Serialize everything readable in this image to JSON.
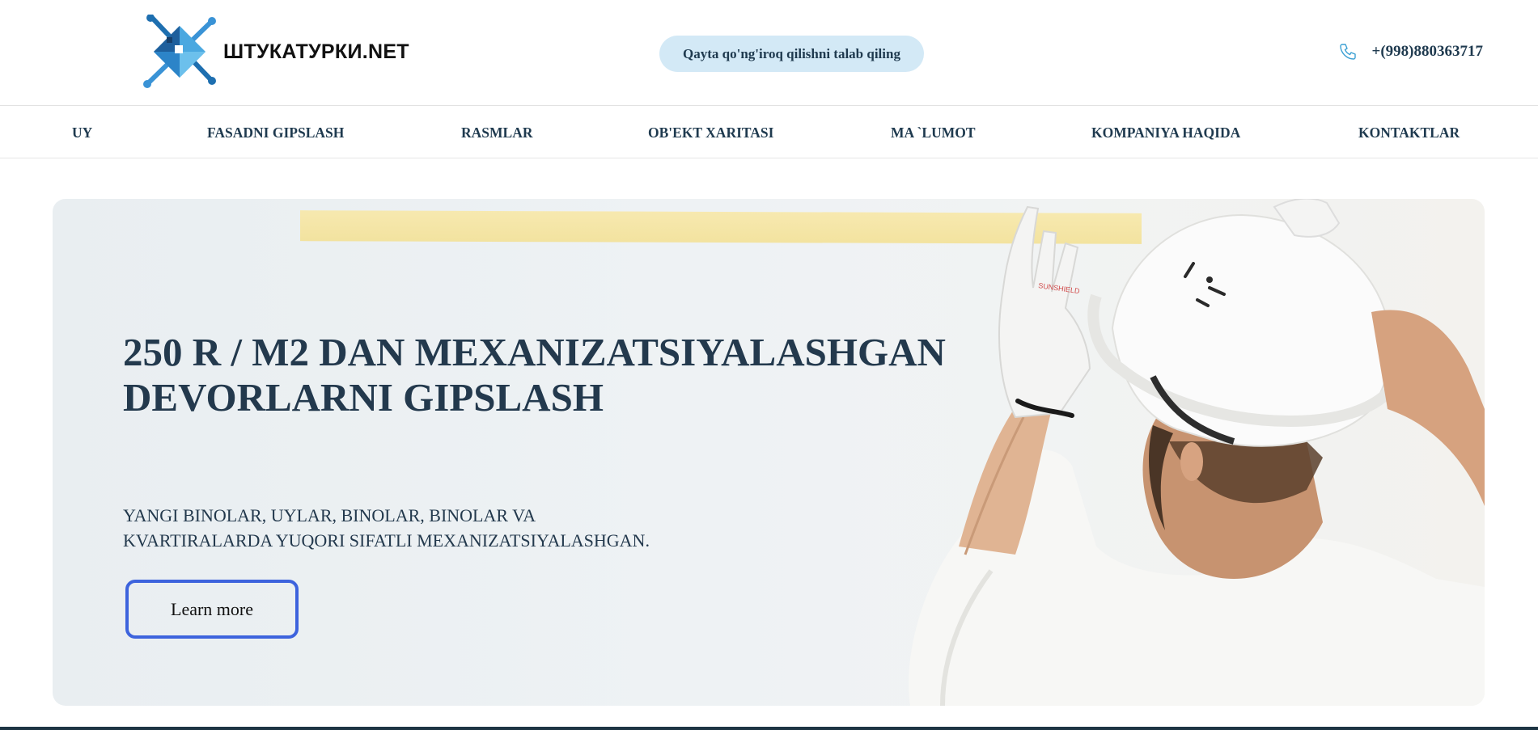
{
  "header": {
    "logo_text": "ШТУКАТУРКИ.NET",
    "logo_icon": "trowel-diamond-logo",
    "callback_label": "Qayta qo'ng'iroq qilishni talab qiling",
    "phone_icon": "phone-icon",
    "phone_number": "+(998)880363717"
  },
  "nav": {
    "items": [
      {
        "label": "UY"
      },
      {
        "label": "FASADNI GIPSLASH"
      },
      {
        "label": "RASMLAR"
      },
      {
        "label": "OB'EKT XARITASI"
      },
      {
        "label": "MA `LUMOT"
      },
      {
        "label": "KOMPANIYA HAQIDA"
      },
      {
        "label": "KONTAKTLAR"
      }
    ]
  },
  "hero": {
    "title_line1": "250 R / M2 DAN MEXANIZATSIYALASHGAN",
    "title_line2": "DEVORLARNI GIPSLASH",
    "subtitle_line1": "YANGI BINOLAR, UYLAR, BINOLAR, BINOLAR VA",
    "subtitle_line2": "KVARTIRALARDA YUQORI SIFATLI MEXANIZATSIYALASHGAN.",
    "button_label": "Learn more"
  },
  "colors": {
    "accent_light": "#d3e9f6",
    "text_dark": "#1f3a4f",
    "button_border": "#3d63dd"
  }
}
